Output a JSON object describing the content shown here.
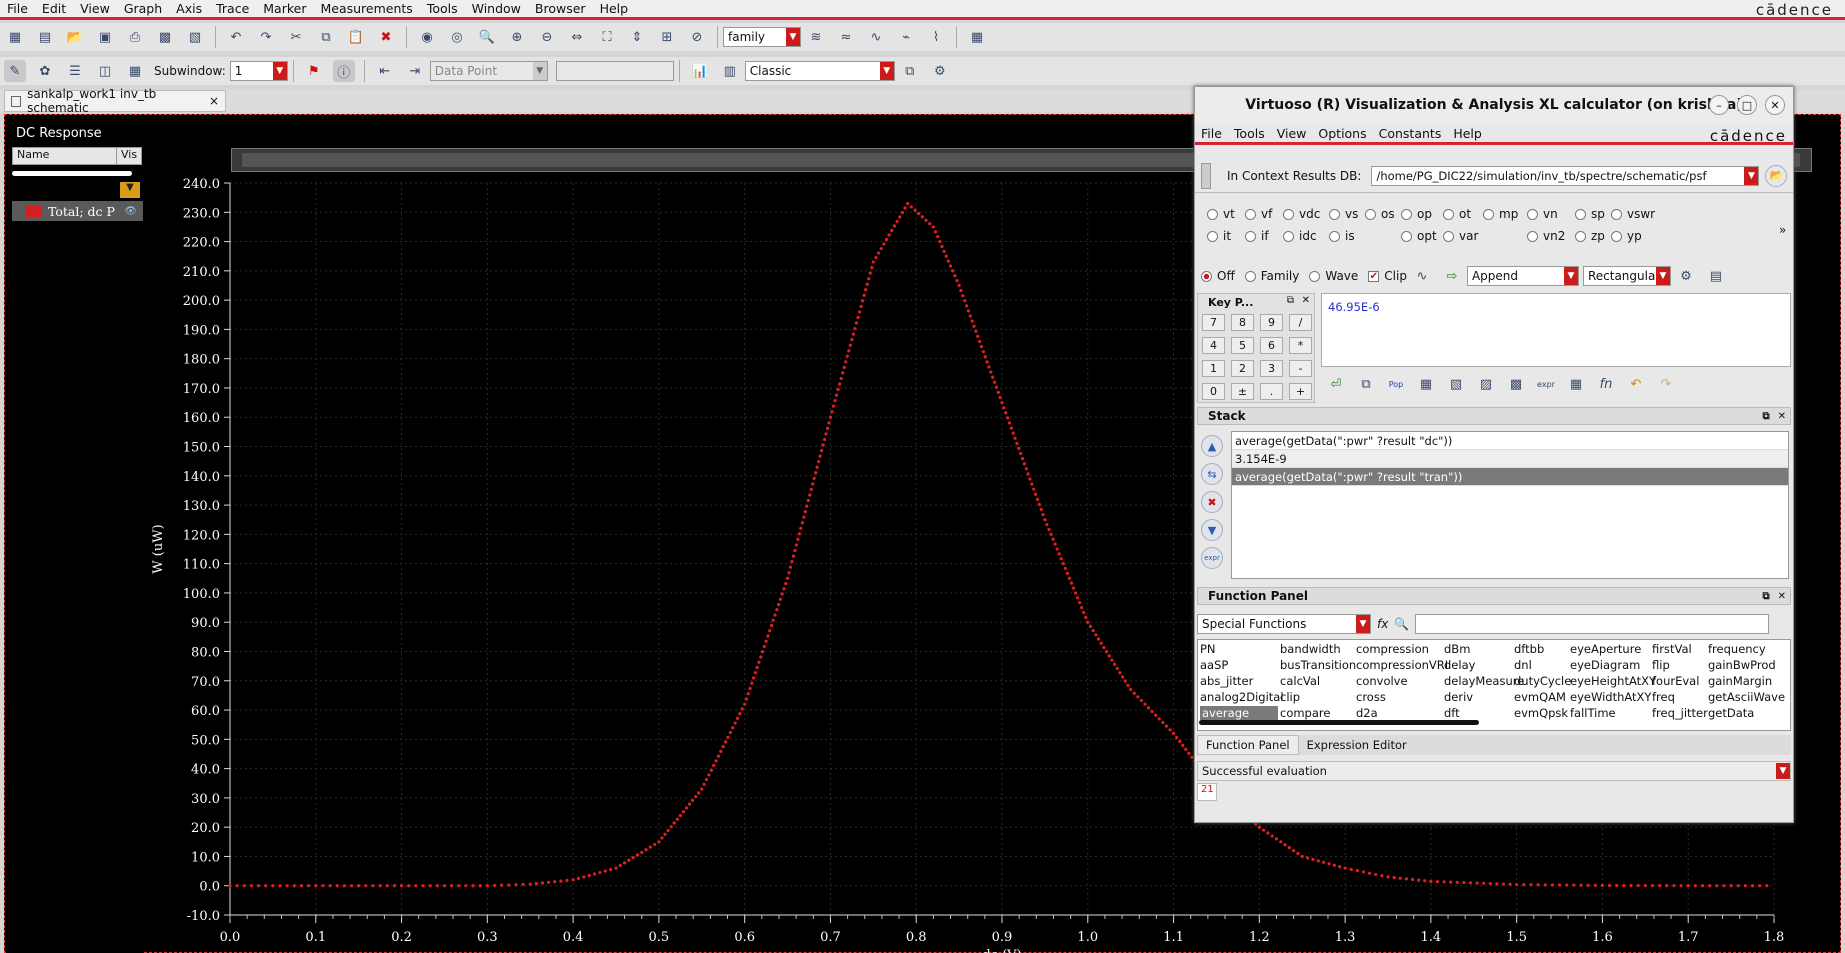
{
  "menubar": {
    "items": [
      "File",
      "Edit",
      "View",
      "Graph",
      "Axis",
      "Trace",
      "Marker",
      "Measurements",
      "Tools",
      "Window",
      "Browser",
      "Help"
    ],
    "brand": "cādence"
  },
  "toolbar1": {
    "family_value": "family"
  },
  "toolbar2": {
    "subwindow_label": "Subwindow:",
    "subwindow_value": "1",
    "data_point_placeholder": "Data Point",
    "style_value": "Classic"
  },
  "tab": {
    "label": "sankalp_work1 inv_tb schematic",
    "close": "×"
  },
  "left_panel": {
    "title": "DC Response",
    "col_name": "Name",
    "col_vis": "Vis",
    "trace_label": "Total; dc P"
  },
  "chart_data": {
    "type": "scatter",
    "title": "DC Response",
    "xlabel": "dc (V)",
    "ylabel": "W (uW)",
    "xlim": [
      0.0,
      1.8
    ],
    "ylim": [
      -10.0,
      240.0
    ],
    "x_ticks": [
      "0.0",
      "0.1",
      "0.2",
      "0.3",
      "0.4",
      "0.5",
      "0.6",
      "0.7",
      "0.8",
      "0.9",
      "1.0",
      "1.1",
      "1.2",
      "1.3",
      "1.4",
      "1.5",
      "1.6",
      "1.7",
      "1.8"
    ],
    "y_ticks": [
      "-10.0",
      "0.0",
      "10.0",
      "20.0",
      "30.0",
      "40.0",
      "50.0",
      "60.0",
      "70.0",
      "80.0",
      "90.0",
      "100.0",
      "110.0",
      "120.0",
      "130.0",
      "140.0",
      "150.0",
      "160.0",
      "170.0",
      "180.0",
      "190.0",
      "200.0",
      "210.0",
      "220.0",
      "230.0",
      "240.0"
    ],
    "series": [
      {
        "name": "Total; dc P",
        "color": "#e02020",
        "x": [
          0.0,
          0.1,
          0.2,
          0.3,
          0.35,
          0.4,
          0.45,
          0.5,
          0.55,
          0.6,
          0.65,
          0.7,
          0.75,
          0.79,
          0.82,
          0.85,
          0.9,
          0.95,
          1.0,
          1.05,
          1.1,
          1.15,
          1.2,
          1.25,
          1.3,
          1.35,
          1.4,
          1.5,
          1.6,
          1.7,
          1.8
        ],
        "values": [
          0.0,
          0.0,
          0.0,
          0.0,
          0.5,
          2.0,
          6.0,
          15.0,
          33.0,
          62.0,
          105.0,
          160.0,
          213.0,
          233.0,
          225.0,
          205.0,
          165.0,
          125.0,
          90.0,
          67.0,
          52.0,
          33.0,
          20.0,
          10.0,
          6.0,
          3.0,
          1.5,
          0.4,
          0.1,
          0.0,
          0.0
        ]
      }
    ],
    "grid": true
  },
  "calculator": {
    "title": "Virtuoso (R) Visualization & Analysis XL calculator (on krishna)",
    "menu": [
      "File",
      "Tools",
      "View",
      "Options",
      "Constants",
      "Help"
    ],
    "brand": "cādence",
    "context_label": "In Context Results DB:",
    "context_path": "/home/PG_DIC22/simulation/inv_tb/spectre/schematic/psf",
    "radios_row1": [
      "vt",
      "vf",
      "vdc",
      "vs",
      "os",
      "op",
      "ot",
      "mp",
      "vn",
      "sp",
      "vswr"
    ],
    "radios_row2": [
      "it",
      "if",
      "idc",
      "is",
      "opt",
      "var",
      "vn2",
      "zp",
      "yp"
    ],
    "mode_off": "Off",
    "mode_family": "Family",
    "mode_wave": "Wave",
    "clip_label": "Clip",
    "append_value": "Append",
    "rect_value": "Rectangular",
    "keypad_title": "Key P...",
    "keys": [
      "7",
      "8",
      "9",
      "/",
      "4",
      "5",
      "6",
      "*",
      "1",
      "2",
      "3",
      "-",
      "0",
      "±",
      ".",
      "+"
    ],
    "buffer_value": "46.95E-6",
    "stack_title": "Stack",
    "stack_items": [
      "average(getData(\":pwr\" ?result \"dc\"))",
      "3.154E-9",
      "average(getData(\":pwr\" ?result \"tran\"))"
    ],
    "function_panel_title": "Function Panel",
    "function_category": "Special Functions",
    "functions": [
      [
        "PN",
        "aaSP",
        "abs_jitter",
        "analog2Digital",
        "average"
      ],
      [
        "bandwidth",
        "busTransition",
        "calcVal",
        "clip",
        "compare"
      ],
      [
        "compression",
        "compressionVRI",
        "convolve",
        "cross",
        "d2a"
      ],
      [
        "dBm",
        "delay",
        "delayMeasure",
        "deriv",
        "dft"
      ],
      [
        "dftbb",
        "dnl",
        "dutyCycle",
        "evmQAM",
        "evmQpsk"
      ],
      [
        "eyeAperture",
        "eyeDiagram",
        "eyeHeightAtXY",
        "eyeWidthAtXY",
        "fallTime"
      ],
      [
        "firstVal",
        "flip",
        "fourEval",
        "freq",
        "freq_jitter"
      ],
      [
        "frequency",
        "gainBwProd",
        "gainMargin",
        "getAsciiWave",
        "getData"
      ]
    ],
    "tab_function_panel": "Function Panel",
    "tab_expression_editor": "Expression Editor",
    "status": "Successful evaluation",
    "line_no": "21"
  }
}
